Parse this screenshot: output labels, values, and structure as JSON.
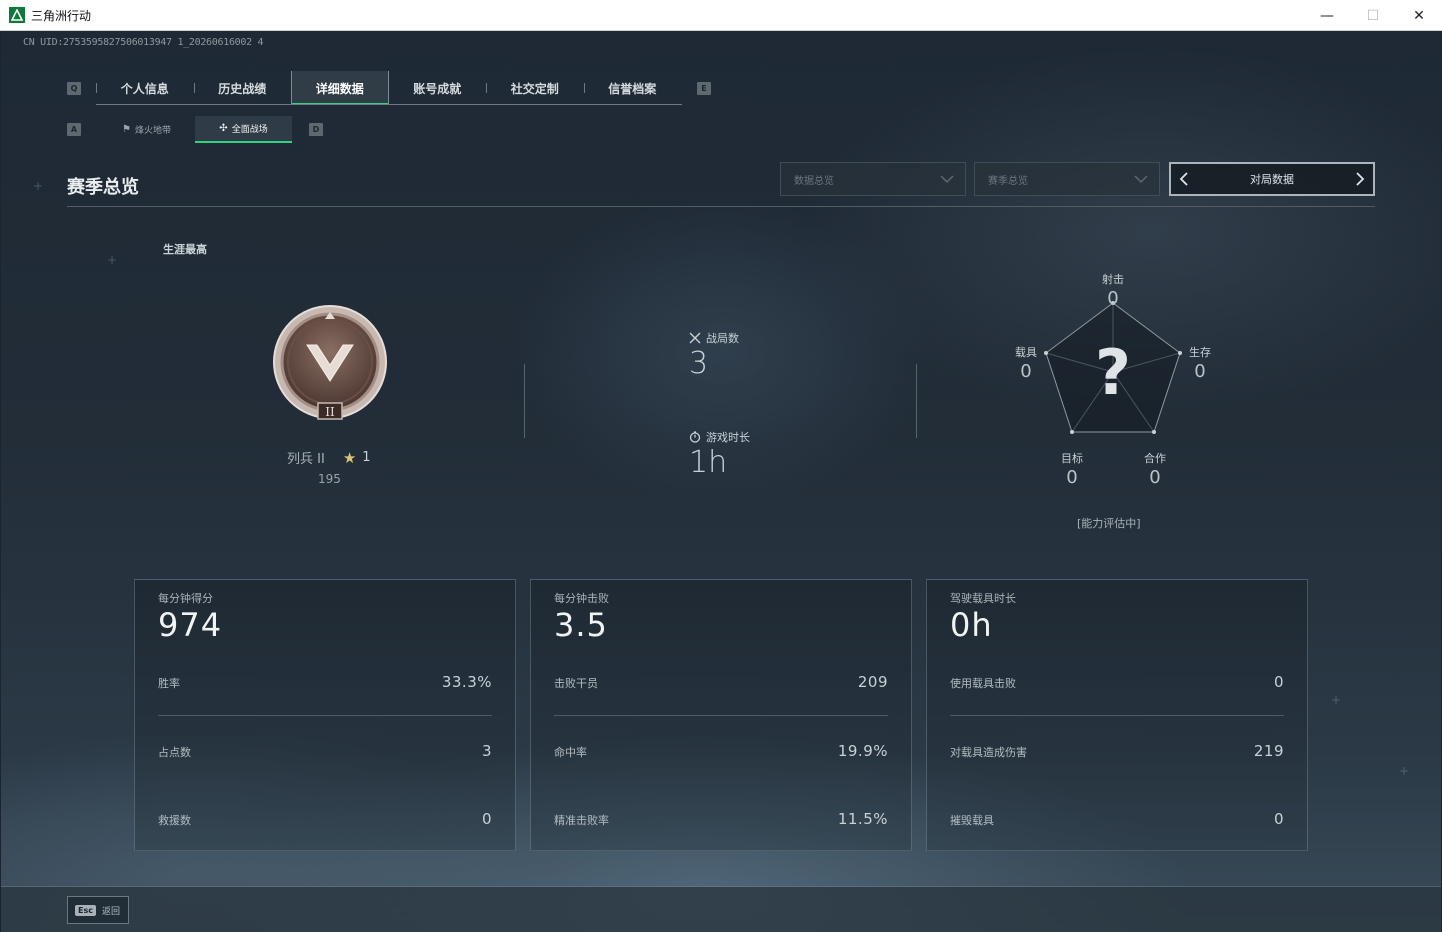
{
  "window": {
    "title": "三角洲行动",
    "minimize": "—",
    "maximize": "☐",
    "close": "✕"
  },
  "uid": "CN UID:2753595827506013947 1_20260616002 4",
  "ghost_title": "",
  "tab_keys": {
    "left": "Q",
    "right": "E"
  },
  "tabs": [
    {
      "label": "个人信息"
    },
    {
      "label": "历史战绩"
    },
    {
      "label": "详细数据"
    },
    {
      "label": "账号成就"
    },
    {
      "label": "社交定制"
    },
    {
      "label": "信誉档案"
    }
  ],
  "active_tab": 2,
  "subtab_keys": {
    "left": "A",
    "right": "D"
  },
  "subtabs": [
    {
      "label": "烽火地带",
      "icon": "flame-zone-icon"
    },
    {
      "label": "全面战场",
      "icon": "battlefield-icon"
    }
  ],
  "active_subtab": 1,
  "section": {
    "title": "赛季总览",
    "dropdown1": "数据总览",
    "dropdown2": "赛季总览",
    "pager_label": "对局数据"
  },
  "overview": {
    "career_label": "生涯最高",
    "rank_name": "列兵 II",
    "rank_numeral": "II",
    "rank_stars": "1",
    "rank_score": "195",
    "matches_label": "战局数",
    "matches_value": "3",
    "time_label": "游戏时长",
    "time_value": "1h"
  },
  "radar": {
    "center_mark": "?",
    "note": "[能力评估中]",
    "axes": [
      {
        "label": "射击",
        "value": "0"
      },
      {
        "label": "生存",
        "value": "0"
      },
      {
        "label": "合作",
        "value": "0"
      },
      {
        "label": "目标",
        "value": "0"
      },
      {
        "label": "载具",
        "value": "0"
      }
    ]
  },
  "cards": [
    {
      "head_label": "每分钟得分",
      "head_value": "974",
      "rows": [
        {
          "label": "胜率",
          "value": "33.3%"
        },
        {
          "label": "占点数",
          "value": "3"
        },
        {
          "label": "救援数",
          "value": "0"
        }
      ]
    },
    {
      "head_label": "每分钟击败",
      "head_value": "3.5",
      "rows": [
        {
          "label": "击败干员",
          "value": "209"
        },
        {
          "label": "命中率",
          "value": "19.9%"
        },
        {
          "label": "精准击败率",
          "value": "11.5%"
        }
      ]
    },
    {
      "head_label": "驾驶载具时长",
      "head_value": "0h",
      "rows": [
        {
          "label": "使用载具击败",
          "value": "0"
        },
        {
          "label": "对载具造成伤害",
          "value": "219"
        },
        {
          "label": "摧毁载具",
          "value": "0"
        }
      ]
    }
  ],
  "footer": {
    "esc_key": "Esc",
    "esc_label": "返回"
  },
  "colors": {
    "accent": "#2fd37e",
    "text": "#c9d1d6",
    "bg": "#1b2530"
  }
}
